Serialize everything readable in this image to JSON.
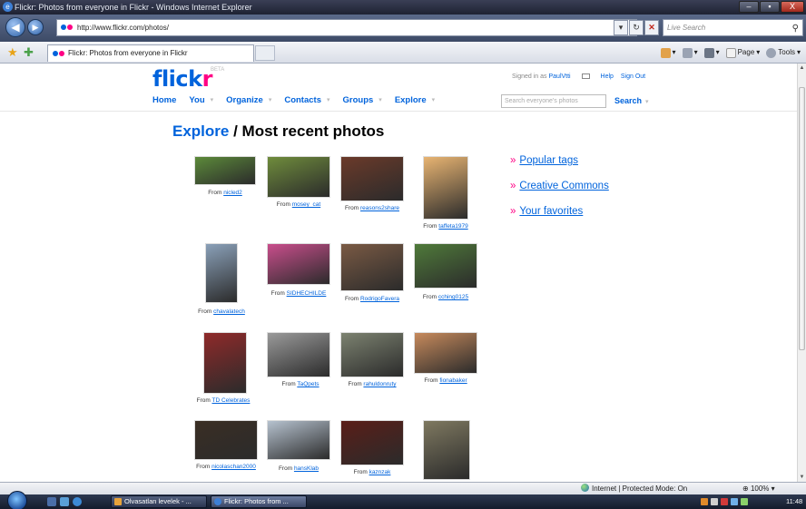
{
  "window": {
    "title": "Flickr: Photos from everyone in Flickr - Windows Internet Explorer",
    "controls": [
      "–",
      "▪",
      "X"
    ]
  },
  "address_bar": {
    "url": "http://www.flickr.com/photos/",
    "search_placeholder": "Live Search"
  },
  "tab": {
    "label": "Flickr: Photos from everyone in Flickr"
  },
  "command_bar": {
    "items": [
      "Page",
      "Tools"
    ]
  },
  "site": {
    "logo_main": "flick",
    "logo_accent": "r",
    "logo_suffix": "BETA",
    "nav": [
      "Home",
      "You",
      "Organize",
      "Contacts",
      "Groups",
      "Explore"
    ],
    "signed_in_prefix": "Signed in as",
    "signed_in_user": "PaulVtti",
    "help": "Help",
    "sign_out": "Sign Out",
    "search_placeholder": "Search everyone's photos",
    "search_button": "Search"
  },
  "heading": {
    "prefix": "Explore",
    "separator": " / ",
    "title": "Most recent photos"
  },
  "photos": [
    {
      "from": "From",
      "user": "nicled2",
      "color": "#5c8a3a"
    },
    {
      "from": "From",
      "user": "mosey_cat",
      "color": "#6f8c3c"
    },
    {
      "from": "From",
      "user": "reasons2share",
      "color": "#6b3a2a"
    },
    {
      "from": "From",
      "user": "taffeta1979",
      "color": "#e8b472"
    },
    {
      "from": "From",
      "user": "chavalatech",
      "color": "#8aa0b8"
    },
    {
      "from": "From",
      "user": "SIDHECHILDE",
      "color": "#c94e8c"
    },
    {
      "from": "From",
      "user": "RodrigoFavera",
      "color": "#7a5a44"
    },
    {
      "from": "From",
      "user": "cching0125",
      "color": "#4f7a3a"
    },
    {
      "from": "From",
      "user": "TD Celebrates",
      "color": "#8f2a2a"
    },
    {
      "from": "From",
      "user": "TaQpets",
      "color": "#9a9a9a"
    },
    {
      "from": "From",
      "user": "rahuldonruty",
      "color": "#7c8270"
    },
    {
      "from": "From",
      "user": "fionabaker",
      "color": "#c78a5c"
    },
    {
      "from": "From",
      "user": "nicolaschan2000",
      "color": "#3a2e24"
    },
    {
      "from": "From",
      "user": "hansKlab",
      "color": "#b6c2cf"
    },
    {
      "from": "From",
      "user": "kaznzak",
      "color": "#5a1e18"
    },
    {
      "from": "",
      "user": "",
      "color": "#7e7860"
    }
  ],
  "sidebar_links": [
    {
      "marker": "»",
      "label": "Popular tags"
    },
    {
      "marker": "»",
      "label": "Creative Commons"
    },
    {
      "marker": "»",
      "label": "Your favorites"
    }
  ],
  "status_bar": {
    "zone": "Internet | Protected Mode: On",
    "zoom": "100%"
  },
  "taskbar": {
    "tasks": [
      "Olvasatlan levelek - ...",
      "Flickr: Photos from ..."
    ],
    "clock": "11:48"
  }
}
